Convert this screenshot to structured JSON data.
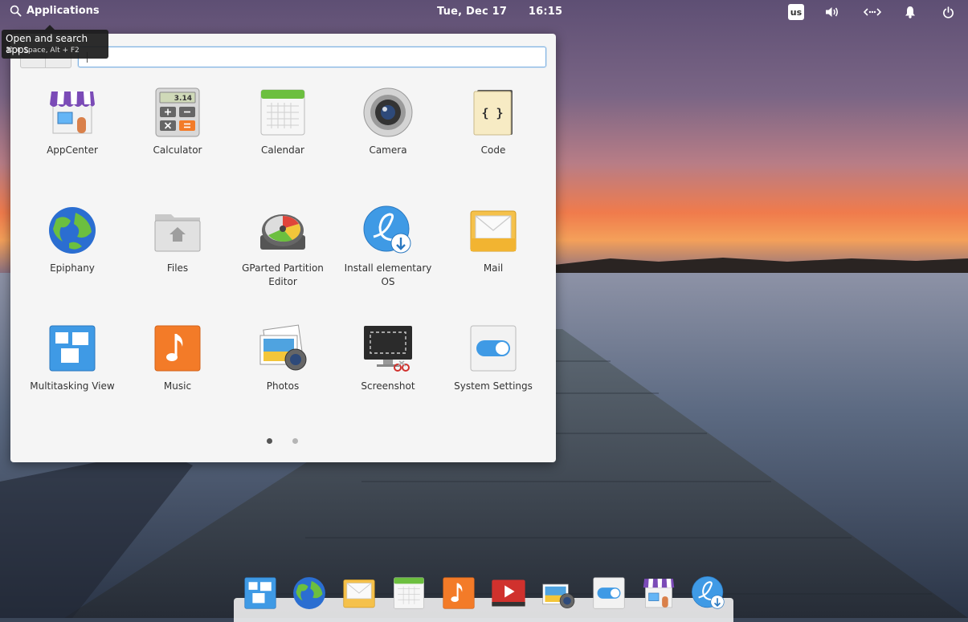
{
  "panel": {
    "applications_label": "Applications",
    "date": "Tue, Dec 17",
    "time": "16:15",
    "keyboard_layout": "us"
  },
  "tooltip": {
    "title": "Open and search apps",
    "shortcut": "⌘ + Space, Alt + F2"
  },
  "launcher": {
    "search_value": "",
    "apps": [
      {
        "label": "AppCenter",
        "icon": "appcenter-icon"
      },
      {
        "label": "Calculator",
        "icon": "calculator-icon",
        "display": "3.14"
      },
      {
        "label": "Calendar",
        "icon": "calendar-icon"
      },
      {
        "label": "Camera",
        "icon": "camera-icon"
      },
      {
        "label": "Code",
        "icon": "code-icon",
        "glyph": "{ }"
      },
      {
        "label": "Epiphany",
        "icon": "epiphany-icon"
      },
      {
        "label": "Files",
        "icon": "files-icon"
      },
      {
        "label": "GParted Partition Editor",
        "icon": "gparted-icon"
      },
      {
        "label": "Install elementary OS",
        "icon": "installer-icon"
      },
      {
        "label": "Mail",
        "icon": "mail-icon"
      },
      {
        "label": "Multitasking View",
        "icon": "multitasking-icon"
      },
      {
        "label": "Music",
        "icon": "music-icon"
      },
      {
        "label": "Photos",
        "icon": "photos-icon"
      },
      {
        "label": "Screenshot",
        "icon": "screenshot-icon"
      },
      {
        "label": "System Settings",
        "icon": "settings-icon"
      }
    ],
    "pages": 2,
    "current_page": 1
  },
  "dock": {
    "items": [
      "multitasking-icon",
      "epiphany-icon",
      "mail-icon",
      "calendar-icon",
      "music-icon",
      "videos-icon",
      "photos-icon",
      "settings-icon",
      "appcenter-icon",
      "installer-icon"
    ]
  },
  "colors": {
    "accent": "#3689e6",
    "panel_text": "#ffffff",
    "launcher_bg": "#f5f5f5"
  }
}
